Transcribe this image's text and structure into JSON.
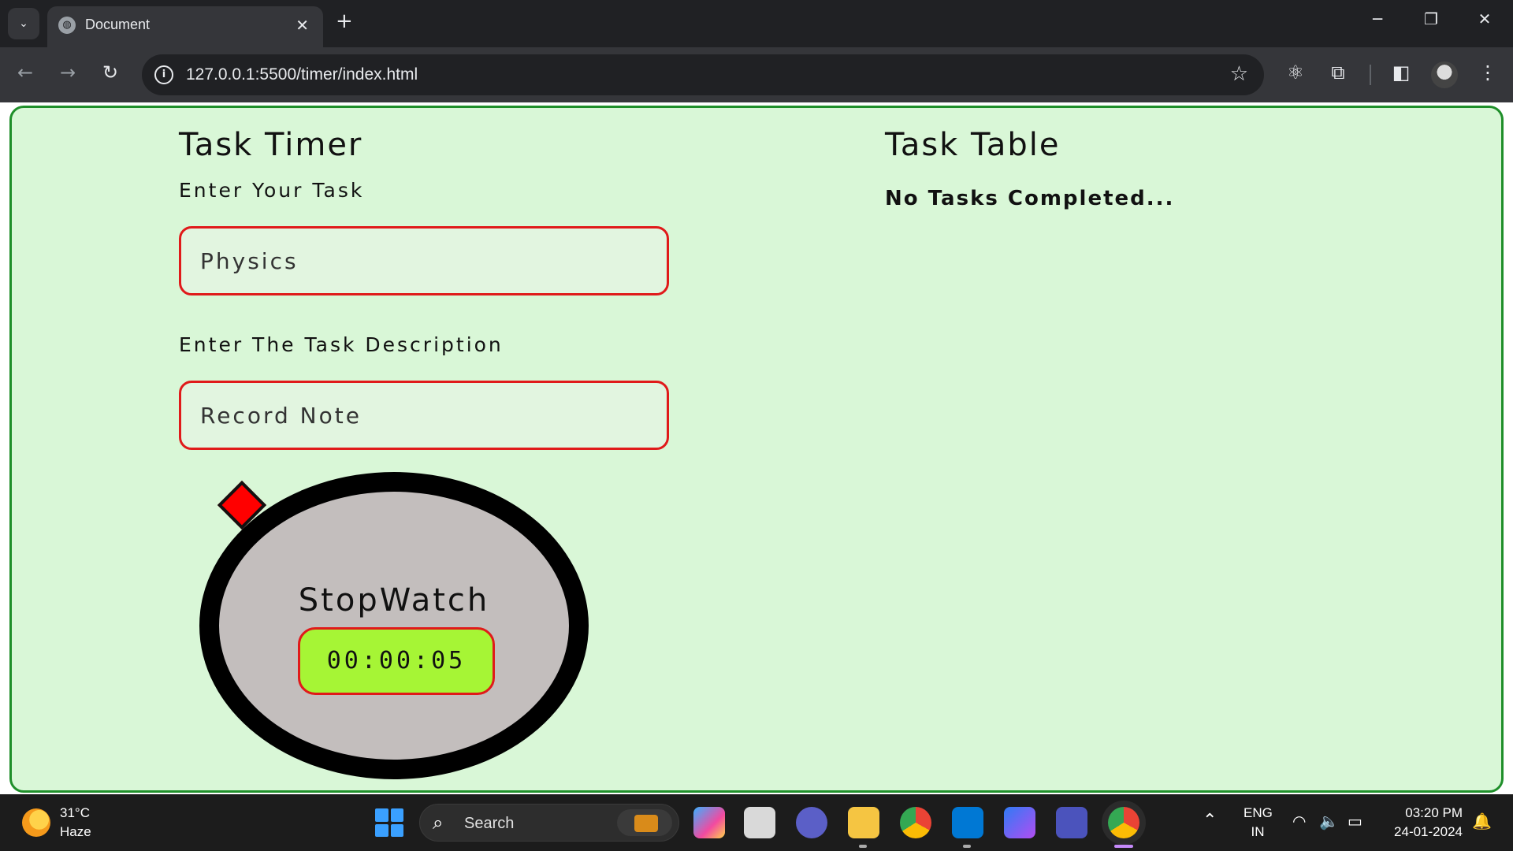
{
  "browser": {
    "tab_title": "Document",
    "tab_close": "✕",
    "new_tab": "+",
    "url": "127.0.0.1:5500/timer/index.html",
    "window_controls": {
      "minimize": "─",
      "restore": "❐",
      "close": "✕"
    }
  },
  "timer_panel": {
    "title": "Task Timer",
    "task_label": "Enter Your Task",
    "task_value": "Physics",
    "description_label": "Enter The Task Description",
    "description_value": "Record Note"
  },
  "stopwatch": {
    "label": "StopWatch",
    "time": "00:00:05"
  },
  "table_panel": {
    "title": "Task Table",
    "empty_message": "No Tasks Completed..."
  },
  "taskbar": {
    "temperature": "31°C",
    "condition": "Haze",
    "search_label": "Search",
    "language": "ENG",
    "region": "IN",
    "time": "03:20 PM",
    "date": "24-01-2024"
  },
  "colors": {
    "page_bg": "#d9f7d7",
    "page_border": "#1f8f2a",
    "input_border": "#e01a1a",
    "stopwatch_display": "#a6f535",
    "stopwatch_face": "#c3bebd"
  }
}
